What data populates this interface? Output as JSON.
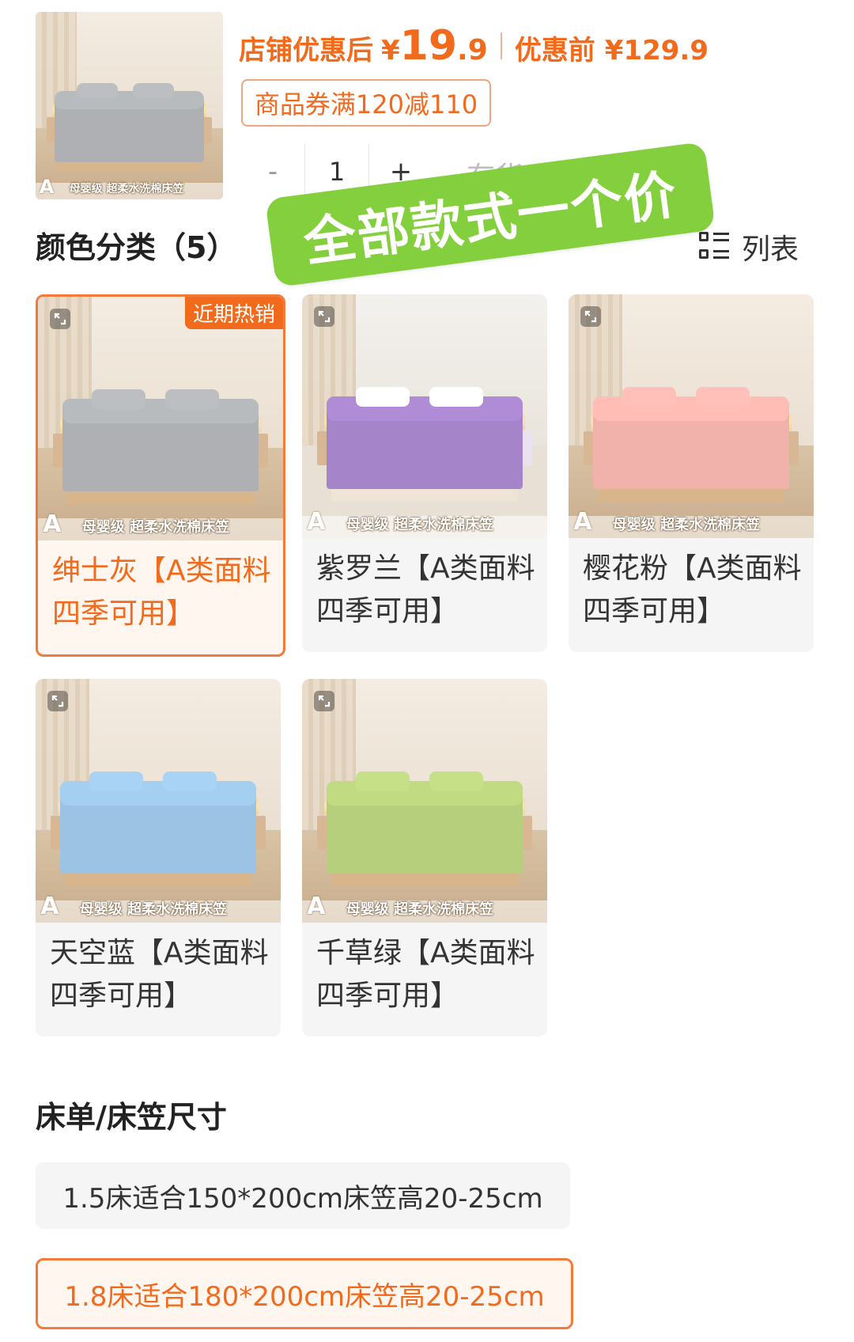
{
  "product": {
    "main_image_badge": "A",
    "main_image_banner": "母婴级 超柔水洗棉床笠"
  },
  "price": {
    "after_label": "店铺优惠后",
    "currency": "¥",
    "after_int": "19",
    "after_dec": ".9",
    "before_label": "优惠前",
    "before_value": "¥129.9"
  },
  "coupon": "商品券满120减110",
  "quantity": {
    "minus": "-",
    "value": "1",
    "plus": "+",
    "stock": "有货"
  },
  "promo_sticker": "全部款式一个价",
  "color_section": {
    "title": "颜色分类（5）",
    "list_toggle_label": "列表",
    "hot_tag": "近期热销",
    "options": [
      {
        "name": "绅士灰【A类面料 四季可用】",
        "color": "#aeb0b3",
        "selected": true
      },
      {
        "name": "紫罗兰【A类面料 四季可用】",
        "color": "#a584c9",
        "selected": false
      },
      {
        "name": "樱花粉【A类面料 四季可用】",
        "color": "#f2b2ac",
        "selected": false
      },
      {
        "name": "天空蓝【A类面料 四季可用】",
        "color": "#9cc3e3",
        "selected": false
      },
      {
        "name": "千草绿【A类面料 四季可用】",
        "color": "#b6cf7c",
        "selected": false
      }
    ]
  },
  "size_section": {
    "title": "床单/床笠尺寸",
    "options": [
      {
        "label": "1.5床适合150*200cm床笠高20-25cm",
        "selected": false
      },
      {
        "label": "1.8床适合180*200cm床笠高20-25cm",
        "selected": true
      }
    ]
  },
  "colors": {
    "accent": "#f26a1b",
    "sticker": "#84cf3e"
  }
}
